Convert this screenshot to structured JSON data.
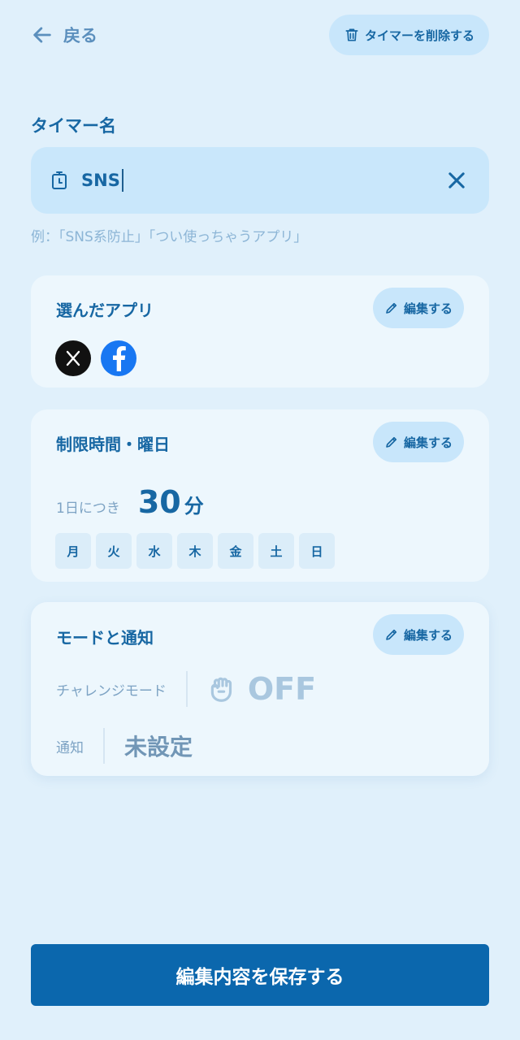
{
  "header": {
    "back_label": "戻る",
    "delete_label": "タイマーを削除する"
  },
  "timer_name": {
    "label": "タイマー名",
    "value": "SNS",
    "hint": "例：「SNS系防止」「つい使っちゃうアプリ」"
  },
  "apps_card": {
    "title": "選んだアプリ",
    "edit_label": "編集する",
    "apps": [
      {
        "icon": "x-logo-icon",
        "color": "#111111"
      },
      {
        "icon": "facebook-logo-icon",
        "color": "#1877f2"
      }
    ]
  },
  "limit_card": {
    "title": "制限時間・曜日",
    "edit_label": "編集する",
    "per_day_label": "1日につき",
    "minutes": "30",
    "unit": "分",
    "days": [
      "月",
      "火",
      "水",
      "木",
      "金",
      "土",
      "日"
    ]
  },
  "mode_card": {
    "title": "モードと通知",
    "edit_label": "編集する",
    "challenge_label": "チャレンジモード",
    "challenge_value": "OFF",
    "notify_label": "通知",
    "notify_value": "未設定"
  },
  "save_label": "編集内容を保存する",
  "colors": {
    "background": "#e0f0fb",
    "accent": "#1767a3",
    "button": "#0b67ad"
  }
}
